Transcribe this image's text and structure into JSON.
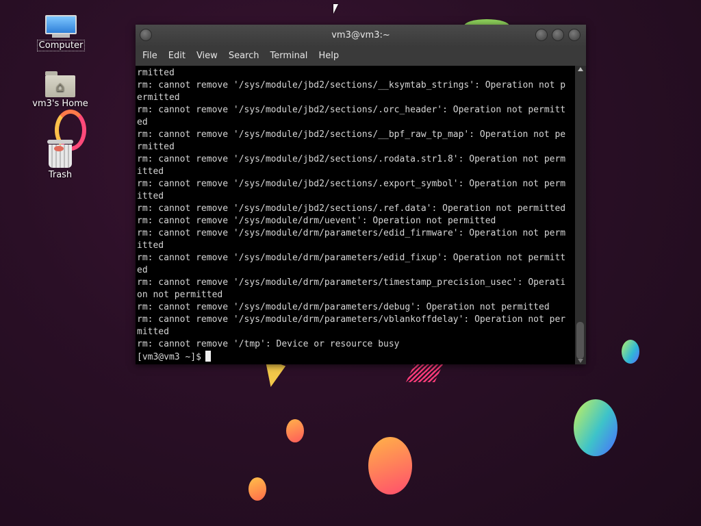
{
  "desktop": {
    "icons": [
      {
        "label": "Computer"
      },
      {
        "label": "vm3's Home"
      },
      {
        "label": "Trash"
      }
    ]
  },
  "window": {
    "title": "vm3@vm3:~",
    "menu": [
      "File",
      "Edit",
      "View",
      "Search",
      "Terminal",
      "Help"
    ]
  },
  "terminal": {
    "lines": [
      "rmitted",
      "rm: cannot remove '/sys/module/jbd2/sections/__ksymtab_strings': Operation not p",
      "ermitted",
      "rm: cannot remove '/sys/module/jbd2/sections/.orc_header': Operation not permitt",
      "ed",
      "rm: cannot remove '/sys/module/jbd2/sections/__bpf_raw_tp_map': Operation not pe",
      "rmitted",
      "rm: cannot remove '/sys/module/jbd2/sections/.rodata.str1.8': Operation not perm",
      "itted",
      "rm: cannot remove '/sys/module/jbd2/sections/.export_symbol': Operation not perm",
      "itted",
      "rm: cannot remove '/sys/module/jbd2/sections/.ref.data': Operation not permitted",
      "rm: cannot remove '/sys/module/drm/uevent': Operation not permitted",
      "rm: cannot remove '/sys/module/drm/parameters/edid_firmware': Operation not perm",
      "itted",
      "rm: cannot remove '/sys/module/drm/parameters/edid_fixup': Operation not permitt",
      "ed",
      "rm: cannot remove '/sys/module/drm/parameters/timestamp_precision_usec': Operati",
      "on not permitted",
      "rm: cannot remove '/sys/module/drm/parameters/debug': Operation not permitted",
      "rm: cannot remove '/sys/module/drm/parameters/vblankoffdelay': Operation not per",
      "mitted",
      "rm: cannot remove '/tmp': Device or resource busy"
    ],
    "prompt": "[vm3@vm3 ~]$"
  }
}
